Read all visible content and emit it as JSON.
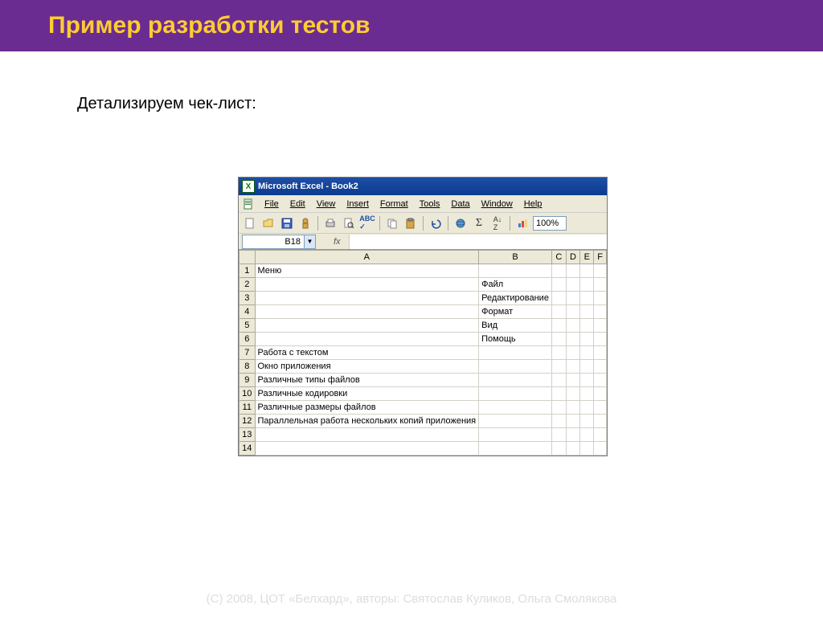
{
  "slide": {
    "title": "Пример разработки тестов",
    "subtitle": "Детализируем чек-лист:",
    "footer": "(C) 2008, ЦОТ «Белхард», авторы: Святослав Куликов, Ольга Смолякова"
  },
  "excel": {
    "window_title": "Microsoft Excel - Book2",
    "menus": [
      "File",
      "Edit",
      "View",
      "Insert",
      "Format",
      "Tools",
      "Data",
      "Window",
      "Help"
    ],
    "toolbar_icons": [
      "new-file-icon",
      "open-icon",
      "save-icon",
      "permission-icon",
      "print-icon",
      "print-preview-icon",
      "spellcheck-icon",
      "copy-icon",
      "paste-icon",
      "undo-icon",
      "hyperlink-icon",
      "autosum-icon",
      "sort-desc-icon",
      "chart-icon"
    ],
    "zoom": "100%",
    "name_box": "B18",
    "fx_label": "fx",
    "columns": [
      "A",
      "B",
      "C",
      "D",
      "E",
      "F"
    ],
    "rows": [
      {
        "n": "1",
        "A": "Меню",
        "B": "",
        "C": "",
        "D": "",
        "E": "",
        "F": ""
      },
      {
        "n": "2",
        "A": "",
        "B": "Файл",
        "C": "",
        "D": "",
        "E": "",
        "F": ""
      },
      {
        "n": "3",
        "A": "",
        "B": "Редактирование",
        "C": "",
        "D": "",
        "E": "",
        "F": ""
      },
      {
        "n": "4",
        "A": "",
        "B": "Формат",
        "C": "",
        "D": "",
        "E": "",
        "F": ""
      },
      {
        "n": "5",
        "A": "",
        "B": "Вид",
        "C": "",
        "D": "",
        "E": "",
        "F": ""
      },
      {
        "n": "6",
        "A": "",
        "B": "Помощь",
        "C": "",
        "D": "",
        "E": "",
        "F": ""
      },
      {
        "n": "7",
        "A": "Работа с текстом",
        "B": "",
        "C": "",
        "D": "",
        "E": "",
        "F": ""
      },
      {
        "n": "8",
        "A": "Окно приложения",
        "B": "",
        "C": "",
        "D": "",
        "E": "",
        "F": ""
      },
      {
        "n": "9",
        "A": "Различные типы файлов",
        "B": "",
        "C": "",
        "D": "",
        "E": "",
        "F": ""
      },
      {
        "n": "10",
        "A": "Различные кодировки",
        "B": "",
        "C": "",
        "D": "",
        "E": "",
        "F": ""
      },
      {
        "n": "11",
        "A": "Различные размеры файлов",
        "B": "",
        "C": "",
        "D": "",
        "E": "",
        "F": ""
      },
      {
        "n": "12",
        "A": "Параллельная работа нескольких копий приложения",
        "B": "",
        "C": "",
        "D": "",
        "E": "",
        "F": ""
      },
      {
        "n": "13",
        "A": "",
        "B": "",
        "C": "",
        "D": "",
        "E": "",
        "F": ""
      },
      {
        "n": "14",
        "A": "",
        "B": "",
        "C": "",
        "D": "",
        "E": "",
        "F": ""
      }
    ]
  }
}
